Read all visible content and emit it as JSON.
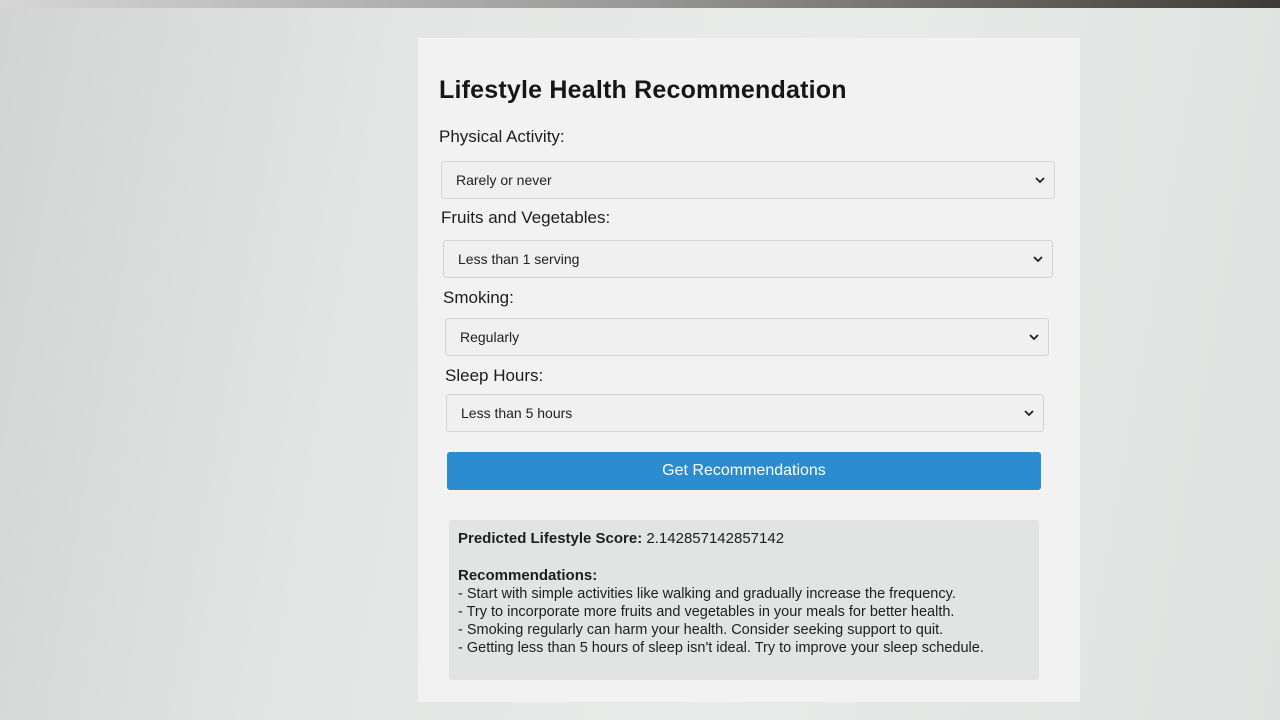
{
  "form": {
    "title": "Lifestyle Health Recommendation",
    "fields": [
      {
        "label": "Physical Activity:",
        "selected": "Rarely or never"
      },
      {
        "label": "Fruits and Vegetables:",
        "selected": "Less than 1 serving"
      },
      {
        "label": "Smoking:",
        "selected": "Regularly"
      },
      {
        "label": "Sleep Hours:",
        "selected": "Less than 5 hours"
      }
    ],
    "submit_label": "Get Recommendations"
  },
  "result": {
    "score_label": "Predicted Lifestyle Score:",
    "score_value": "2.142857142857142",
    "recommendations_heading": "Recommendations:",
    "recommendations": [
      "- Start with simple activities like walking and gradually increase the frequency.",
      "- Try to incorporate more fruits and vegetables in your meals for better health.",
      "- Smoking regularly can harm your health. Consider seeking support to quit.",
      "- Getting less than 5 hours of sleep isn't ideal. Try to improve your sleep schedule."
    ]
  },
  "colors": {
    "button": "#2b8cd0",
    "card": "#f1f2f1",
    "result_box": "#e2e4e4"
  },
  "icons": {
    "select_arrow": "chevron-down-icon"
  }
}
